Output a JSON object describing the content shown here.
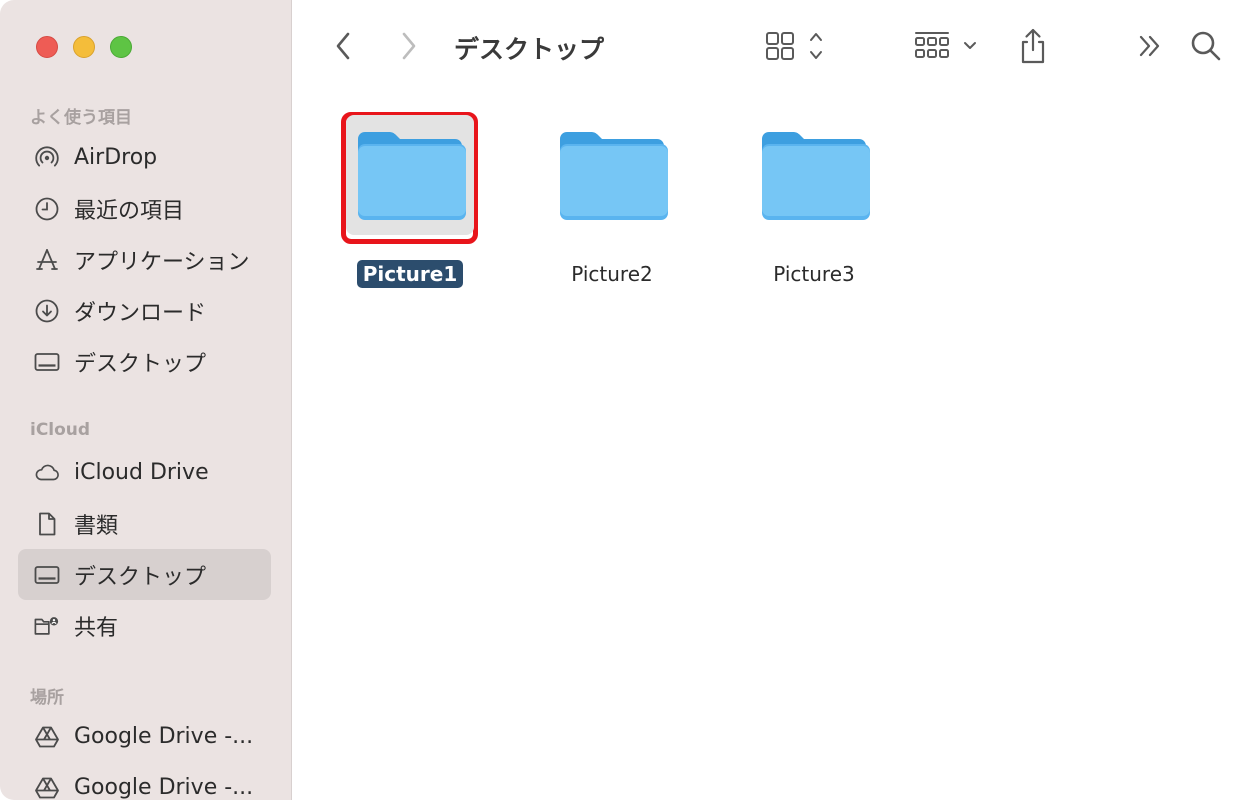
{
  "window": {
    "title": "デスクトップ"
  },
  "sidebar": {
    "favorites_title": "よく使う項目",
    "favorites": [
      {
        "label": "AirDrop",
        "icon": "airdrop-icon"
      },
      {
        "label": "最近の項目",
        "icon": "clock-icon"
      },
      {
        "label": "アプリケーション",
        "icon": "applications-icon"
      },
      {
        "label": "ダウンロード",
        "icon": "download-icon"
      },
      {
        "label": "デスクトップ",
        "icon": "desktop-icon"
      }
    ],
    "icloud_title": "iCloud",
    "icloud": [
      {
        "label": "iCloud Drive",
        "icon": "cloud-icon"
      },
      {
        "label": "書類",
        "icon": "document-icon"
      },
      {
        "label": "デスクトップ",
        "icon": "desktop-icon",
        "active": true
      },
      {
        "label": "共有",
        "icon": "shared-folder-icon"
      }
    ],
    "locations_title": "場所",
    "locations": [
      {
        "label": "Google Drive -...",
        "icon": "google-drive-icon"
      },
      {
        "label": "Google Drive -...",
        "icon": "google-drive-icon"
      }
    ]
  },
  "content": {
    "items": [
      {
        "name": "Picture1",
        "selected": true
      },
      {
        "name": "Picture2",
        "selected": false
      },
      {
        "name": "Picture3",
        "selected": false
      }
    ]
  },
  "colors": {
    "folder_light": "#76c6f5",
    "folder_dark": "#3d9fe0",
    "selection_label": "#2c4d6d",
    "highlight": "#e8151b"
  }
}
